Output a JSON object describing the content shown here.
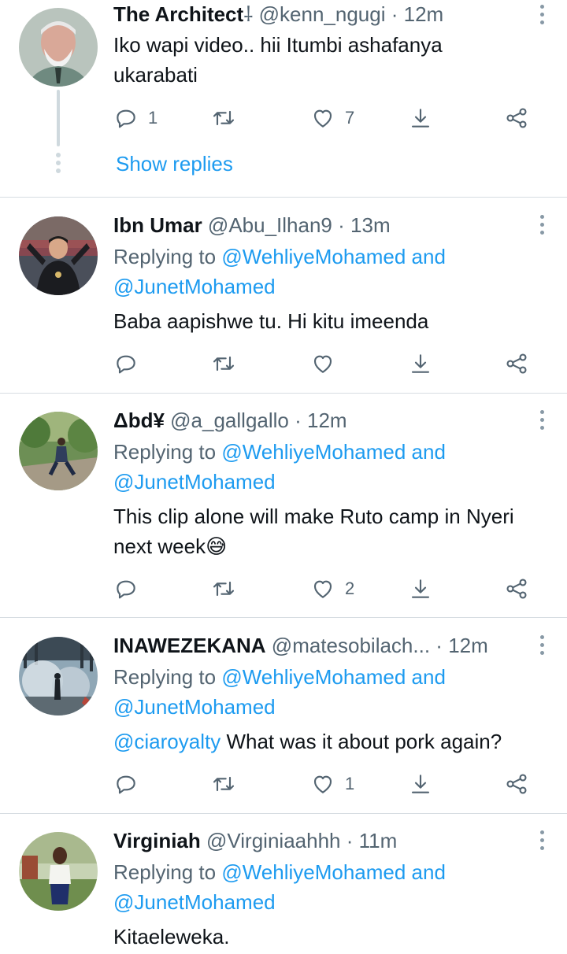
{
  "tweets": [
    {
      "name": "The Architect",
      "name_suffix": "⸸",
      "handle": "@kenn_ngugi",
      "time": "12m",
      "replying_label": "",
      "body_lines": [
        "Iko wapi video.. hii Itumbi ashafanya",
        "ukarabati"
      ],
      "counts": {
        "reply": "1",
        "retweet": "",
        "like": "7"
      },
      "show_replies": "Show replies",
      "avatar": "avatar-bearded-man"
    },
    {
      "name": "Ibn Umar",
      "handle": "@Abu_Ilhan9",
      "time": "13m",
      "replying_label": "Replying to",
      "replying_to_1": "@WehliyeMohamed and",
      "replying_to_2": "@JunetMohamed",
      "body_lines": [
        "Baba aapishwe tu. Hi kitu imeenda"
      ],
      "counts": {
        "reply": "",
        "retweet": "",
        "like": ""
      },
      "avatar": "avatar-coach-stadium"
    },
    {
      "name": "Δbd¥",
      "handle": "@a_gallgallo",
      "time": "12m",
      "replying_label": "Replying to",
      "replying_to_1": "@WehliyeMohamed and",
      "replying_to_2": "@JunetMohamed",
      "body_lines": [
        "This clip alone will make Ruto camp in Nyeri",
        "next week"
      ],
      "emoji": "😅",
      "counts": {
        "reply": "",
        "retweet": "",
        "like": "2"
      },
      "avatar": "avatar-man-on-road"
    },
    {
      "name": "INAWEZEKANA",
      "handle": "@matesobilach...",
      "time": "12m",
      "replying_label": "Replying to",
      "replying_to_1": "@WehliyeMohamed and",
      "replying_to_2": "@JunetMohamed",
      "body_mention": "@ciaroyalty",
      "body_lines": [
        "What was it about pork again?"
      ],
      "counts": {
        "reply": "",
        "retweet": "",
        "like": "1"
      },
      "avatar": "avatar-teargas-street"
    },
    {
      "name": "Virginiah",
      "handle": "@Virginiaahhh",
      "time": "11m",
      "replying_label": "Replying to",
      "replying_to_1": "@WehliyeMohamed and",
      "replying_to_2": "@JunetMohamed",
      "body_lines": [
        "Kitaeleweka."
      ],
      "counts": {
        "reply": "",
        "retweet": "",
        "like": ""
      },
      "avatar": "avatar-woman-outdoors"
    }
  ],
  "separator": "·",
  "icons": [
    "reply-icon",
    "retweet-icon",
    "like-icon",
    "save-icon",
    "share-icon",
    "more-icon"
  ],
  "colors": {
    "link": "#1d9bf0",
    "muted": "#536471",
    "divider": "#d7dde2",
    "icon": "#536471"
  }
}
